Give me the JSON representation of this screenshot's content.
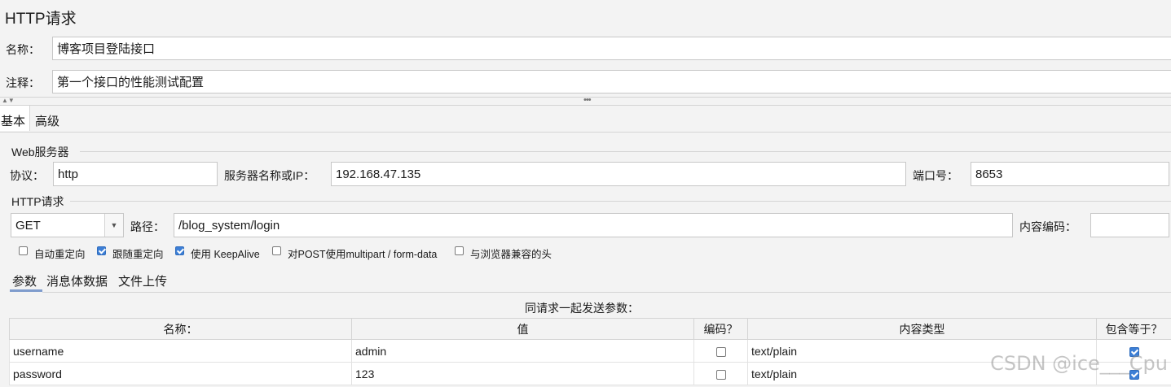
{
  "header": {
    "title": "HTTP请求"
  },
  "form": {
    "name_label": "名称：",
    "name_value": "博客项目登陆接口",
    "comment_label": "注释：",
    "comment_value": "第一个接口的性能测试配置"
  },
  "tabs": {
    "basic": "基本",
    "advanced": "高级"
  },
  "web_server": {
    "group_label": "Web服务器",
    "protocol_label": "协议：",
    "protocol_value": "http",
    "server_label": "服务器名称或IP：",
    "server_value": "192.168.47.135",
    "port_label": "端口号：",
    "port_value": "8653"
  },
  "http_request": {
    "group_label": "HTTP请求",
    "method": "GET",
    "path_label": "路径：",
    "path_value": "/blog_system/login",
    "encoding_label": "内容编码：",
    "encoding_value": ""
  },
  "options": {
    "auto_redirect": {
      "label": "自动重定向",
      "checked": false
    },
    "follow_redirect": {
      "label": "跟随重定向",
      "checked": true
    },
    "keepalive": {
      "label": "使用 KeepAlive",
      "checked": true
    },
    "multipart": {
      "label": "对POST使用multipart / form-data",
      "checked": false
    },
    "browser_headers": {
      "label": "与浏览器兼容的头",
      "checked": false
    }
  },
  "subtabs": {
    "params": "参数",
    "body": "消息体数据",
    "files": "文件上传"
  },
  "params_section": {
    "caption": "同请求一起发送参数：",
    "columns": [
      "名称：",
      "值",
      "编码？",
      "内容类型",
      "包含等于？"
    ],
    "rows": [
      {
        "name": "username",
        "value": "admin",
        "encode": false,
        "content_type": "text/plain",
        "include_equals": true
      },
      {
        "name": "password",
        "value": "123",
        "encode": false,
        "content_type": "text/plain",
        "include_equals": true
      }
    ]
  },
  "watermark": "CSDN @ice___Cpu"
}
